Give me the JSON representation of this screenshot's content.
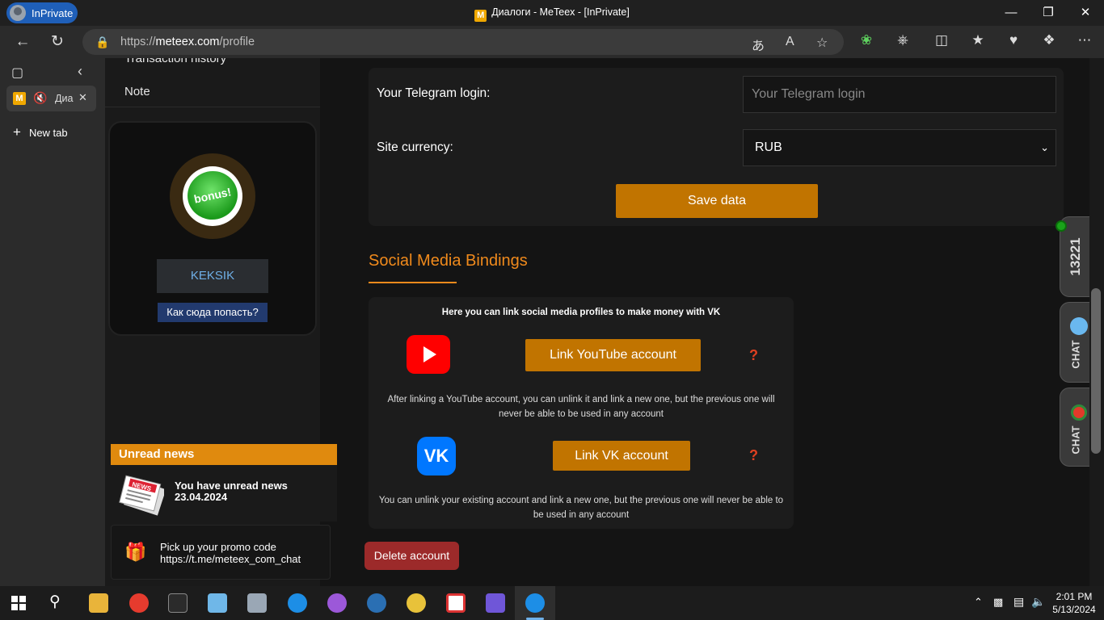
{
  "browser": {
    "inprivate_label": "InPrivate",
    "window_title": "Диалоги - MeTeex - [InPrivate]",
    "favicon_letter": "M",
    "url_prefix": "https://",
    "url_domain": "meteex.com",
    "url_path": "/profile",
    "active_tab_label": "Диа",
    "new_tab_label": "New tab"
  },
  "left_panel": {
    "nav_items": [
      "Transaction history",
      "Note"
    ],
    "bonus_text": "bonus!",
    "user_name": "KEKSIK",
    "howto_label": "Как сюда попасть?",
    "news_header": "Unread news",
    "news_icon_text": "NEWS",
    "news_text": "You have unread news",
    "news_date": "23.04.2024",
    "promo_line1": "Pick up your promo code",
    "promo_line2": "https://t.me/meteex_com_chat"
  },
  "form": {
    "telegram_label": "Your Telegram login:",
    "telegram_placeholder": "Your Telegram login",
    "currency_label": "Site currency:",
    "currency_value": "RUB",
    "save_label": "Save data"
  },
  "social": {
    "title": "Social Media Bindings",
    "intro": "Here you can link social media profiles to make money with VK",
    "youtube_button": "Link YouTube account",
    "youtube_note": "After linking a YouTube account, you can unlink it and link a new one, but the previous one will never be able to be used in any account",
    "vk_button": "Link VK account",
    "vk_note": "You can unlink your existing account and link a new one, but the previous one will never be able to be used in any account",
    "vk_icon_text": "VK",
    "help_mark": "?"
  },
  "delete_label": "Delete account",
  "widgets": {
    "online_count": "13221",
    "chat_label_1": "CHAT",
    "chat_label_2": "CHAT"
  },
  "taskbar": {
    "time": "2:01 PM",
    "date": "5/13/2024"
  },
  "colors": {
    "accent_orange": "#c17400",
    "title_orange": "#f08a1c",
    "delete_red": "#9c2a2a",
    "inprivate_blue": "#1f5fb8"
  }
}
